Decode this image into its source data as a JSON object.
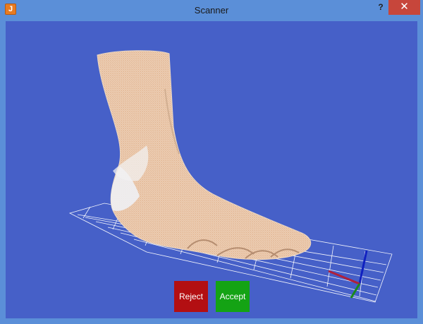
{
  "window": {
    "title": "Scanner",
    "app_icon": "java-icon",
    "help_label": "?",
    "close_label": "✕"
  },
  "viewport": {
    "background": "#4660c8",
    "model": "3D foot scan",
    "grid_color": "#ffffff",
    "axis_colors": {
      "x": "#b0203a",
      "y": "#1a8a1a",
      "z": "#1020c0"
    }
  },
  "actions": {
    "reject_label": "Reject",
    "accept_label": "Accept",
    "reject_color": "#b30f12",
    "accept_color": "#14a314"
  }
}
